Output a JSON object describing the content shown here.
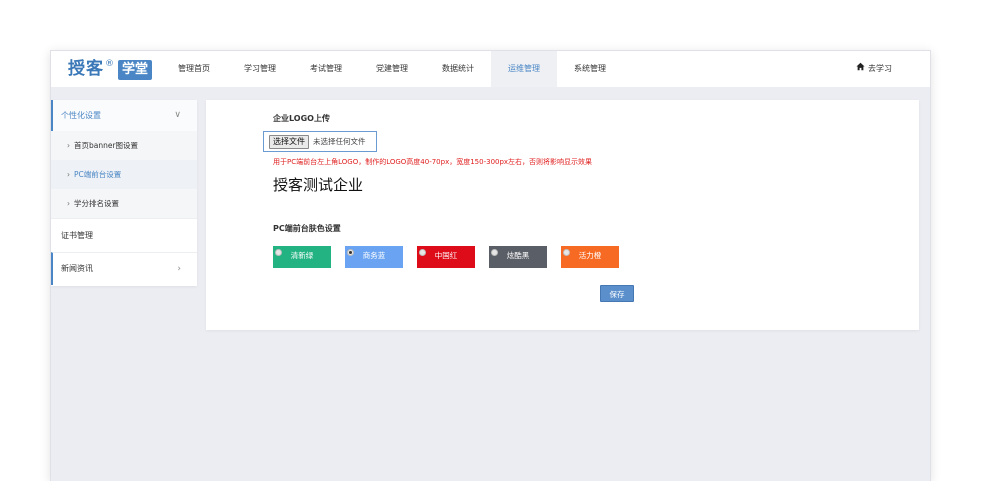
{
  "logo": {
    "text": "授客",
    "reg": "®",
    "box": "学堂"
  },
  "nav": {
    "items": [
      {
        "label": "管理首页"
      },
      {
        "label": "学习管理"
      },
      {
        "label": "考试管理"
      },
      {
        "label": "党建管理"
      },
      {
        "label": "数据统计"
      },
      {
        "label": "运维管理",
        "active": true
      },
      {
        "label": "系统管理"
      }
    ],
    "study_link": "去学习"
  },
  "sidebar": {
    "group1": {
      "label": "个性化设置",
      "chevron": "∨"
    },
    "subs": [
      {
        "label": "首页banner图设置"
      },
      {
        "label": "PC端前台设置",
        "active": true
      },
      {
        "label": "学分排名设置"
      }
    ],
    "certificate": "证书管理",
    "news": {
      "label": "新闻资讯",
      "chevron": "›"
    }
  },
  "main": {
    "logo_section_title": "企业LOGO上传",
    "file_button": "选择文件",
    "file_none": "未选择任何文件",
    "hint": "用于PC端前台左上角LOGO，制作的LOGO高度40-70px，宽度150-300px左右，否则将影响显示效果",
    "company_name": "授客测试企业",
    "skin_section_title": "PC端前台肤色设置",
    "swatches": [
      {
        "label": "清新绿",
        "color": "#23b383",
        "checked": false
      },
      {
        "label": "商务蓝",
        "color": "#6aa3f2",
        "checked": true
      },
      {
        "label": "中国红",
        "color": "#de0b19",
        "checked": false
      },
      {
        "label": "炫酷黑",
        "color": "#5a5e66",
        "checked": false
      },
      {
        "label": "活力橙",
        "color": "#f76a24",
        "checked": false
      }
    ],
    "save_label": "保存"
  },
  "colors": {
    "accent": "#4a86c5",
    "hint": "#e02020"
  },
  "icons": {
    "home": "home-icon"
  }
}
